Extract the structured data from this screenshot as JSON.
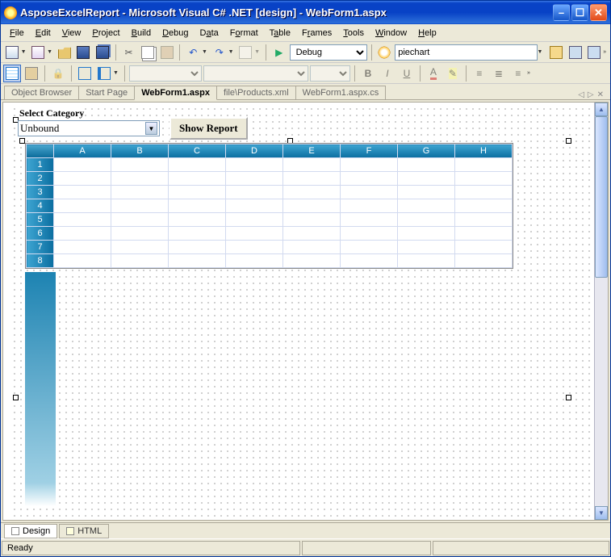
{
  "title": "AsposeExcelReport - Microsoft Visual C# .NET [design] - WebForm1.aspx",
  "menus": [
    "File",
    "Edit",
    "View",
    "Project",
    "Build",
    "Debug",
    "Data",
    "Format",
    "Table",
    "Frames",
    "Tools",
    "Window",
    "Help"
  ],
  "toolbar1": {
    "debug_mode": "Debug",
    "find_text": "piechart"
  },
  "toolbar2": {
    "font_name": "",
    "font_size": ""
  },
  "doc_tabs": [
    {
      "label": "Object Browser",
      "active": false
    },
    {
      "label": "Start Page",
      "active": false
    },
    {
      "label": "WebForm1.aspx",
      "active": true
    },
    {
      "label": "file\\Products.xml",
      "active": false
    },
    {
      "label": "WebForm1.aspx.cs",
      "active": false
    }
  ],
  "designer": {
    "label_text": "Select Category",
    "combo_value": "Unbound",
    "button_text": "Show Report",
    "columns": [
      "A",
      "B",
      "C",
      "D",
      "E",
      "F",
      "G",
      "H"
    ],
    "rows": [
      "1",
      "2",
      "3",
      "4",
      "5",
      "6",
      "7",
      "8"
    ]
  },
  "view_tabs": [
    {
      "label": "Design",
      "active": true
    },
    {
      "label": "HTML",
      "active": false
    }
  ],
  "status": "Ready"
}
